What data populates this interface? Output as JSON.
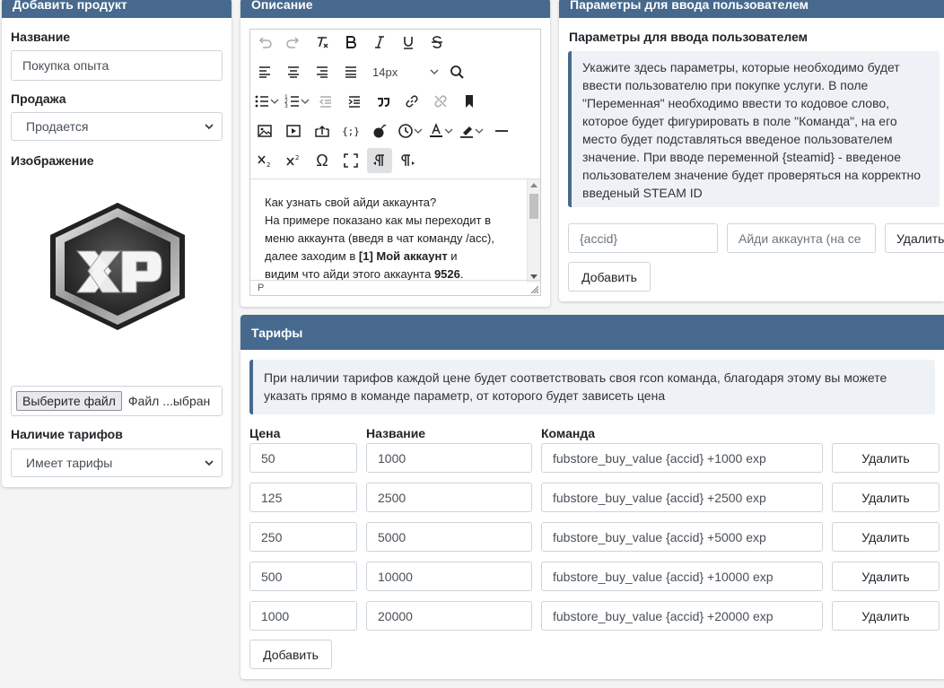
{
  "add_product": {
    "header": "Добавить продукт",
    "name_label": "Название",
    "name_value": "Покупка опыта",
    "sale_label": "Продажа",
    "sale_value": "Продается",
    "image_label": "Изображение",
    "file_button": "Выберите файл",
    "file_status": "Файл ...ыбран",
    "tariffs_label": "Наличие тарифов",
    "tariffs_value": "Имеет тарифы"
  },
  "description": {
    "header": "Описание",
    "font_size": "14px",
    "line1": "Как узнать свой айди аккаунта?",
    "line2": "На примере показано как мы переходит в",
    "line3": "меню аккаунта (введя в чат команду /acc),",
    "line4_pre": "далее заходим в ",
    "line4_bold": "[1] Мой аккаунт",
    "line4_post": " и",
    "line5_pre": "видим что айди этого аккаунта ",
    "line5_bold": "9526",
    "line5_post": ".",
    "status_tag": "P"
  },
  "user_params": {
    "header": "Параметры для ввода пользователем",
    "subtitle": "Параметры для ввода пользователем",
    "info": "Укажите здесь параметры, которые необходимо будет ввести пользователю при покупке услуги. В поле \"Переменная\" необходимо ввести то кодовое слово, которое будет фигурировать в поле \"Команда\", на его место будет подставляться введеное пользователем значение. При вводе переменной {steamid} - введеное пользователем значение будет проверяться на корректно введеный STEAM ID",
    "variable_value": "{accid}",
    "name_value": "Айди аккаунта (на се",
    "delete_label": "Удалить",
    "add_label": "Добавить"
  },
  "tariffs": {
    "header": "Тарифы",
    "info": "При наличии тарифов каждой цене будет соответствовать своя rcon команда, благодаря этому вы можете указать прямо в команде параметр, от которого будет зависеть цена",
    "col_price": "Цена",
    "col_name": "Название",
    "col_command": "Команда",
    "delete_label": "Удалить",
    "add_label": "Добавить",
    "rows": [
      {
        "price": "50",
        "name": "1000",
        "command": "fubstore_buy_value {accid} +1000 exp"
      },
      {
        "price": "125",
        "name": "2500",
        "command": "fubstore_buy_value {accid} +2500 exp"
      },
      {
        "price": "250",
        "name": "5000",
        "command": "fubstore_buy_value {accid} +5000 exp"
      },
      {
        "price": "500",
        "name": "10000",
        "command": "fubstore_buy_value {accid} +10000 exp"
      },
      {
        "price": "1000",
        "name": "20000",
        "command": "fubstore_buy_value {accid} +20000 exp"
      }
    ]
  },
  "logo": {
    "letters": "XP"
  }
}
